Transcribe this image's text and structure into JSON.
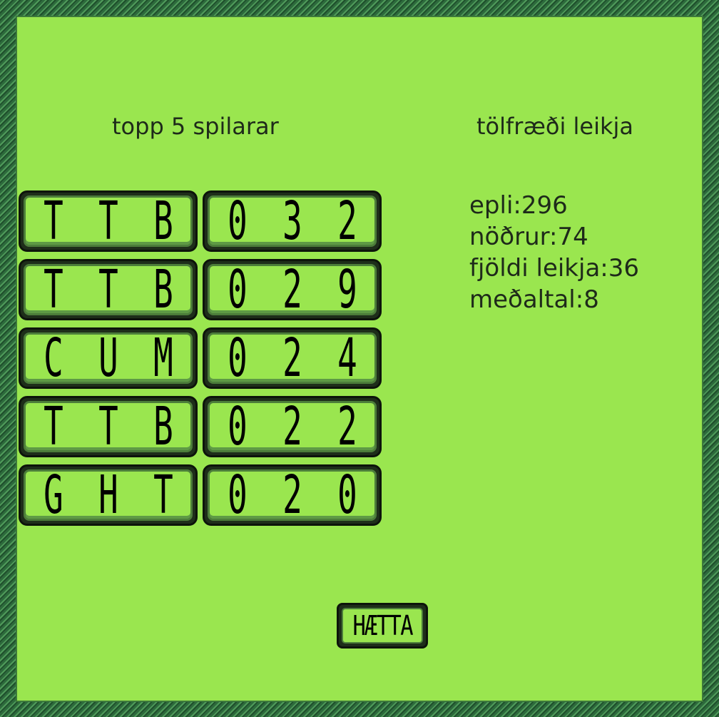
{
  "top5": {
    "title": "topp 5 spilarar",
    "rows": [
      {
        "name": [
          "T",
          "T",
          "B"
        ],
        "score": [
          "0",
          "3",
          "2"
        ]
      },
      {
        "name": [
          "T",
          "T",
          "B"
        ],
        "score": [
          "0",
          "2",
          "9"
        ]
      },
      {
        "name": [
          "C",
          "U",
          "M"
        ],
        "score": [
          "0",
          "2",
          "4"
        ]
      },
      {
        "name": [
          "T",
          "T",
          "B"
        ],
        "score": [
          "0",
          "2",
          "2"
        ]
      },
      {
        "name": [
          "G",
          "H",
          "T"
        ],
        "score": [
          "0",
          "2",
          "0"
        ]
      }
    ]
  },
  "stats": {
    "title": "tölfræði leikja",
    "lines": [
      "epli:296",
      "nöðrur:74",
      "fjöldi leikja:36",
      "meðaltal:8"
    ]
  },
  "quit_button": {
    "label": "HÆTTA"
  },
  "colors": {
    "background": "#9ae64f",
    "frame": "#2f6b3f",
    "text": "#1e2a1a"
  }
}
